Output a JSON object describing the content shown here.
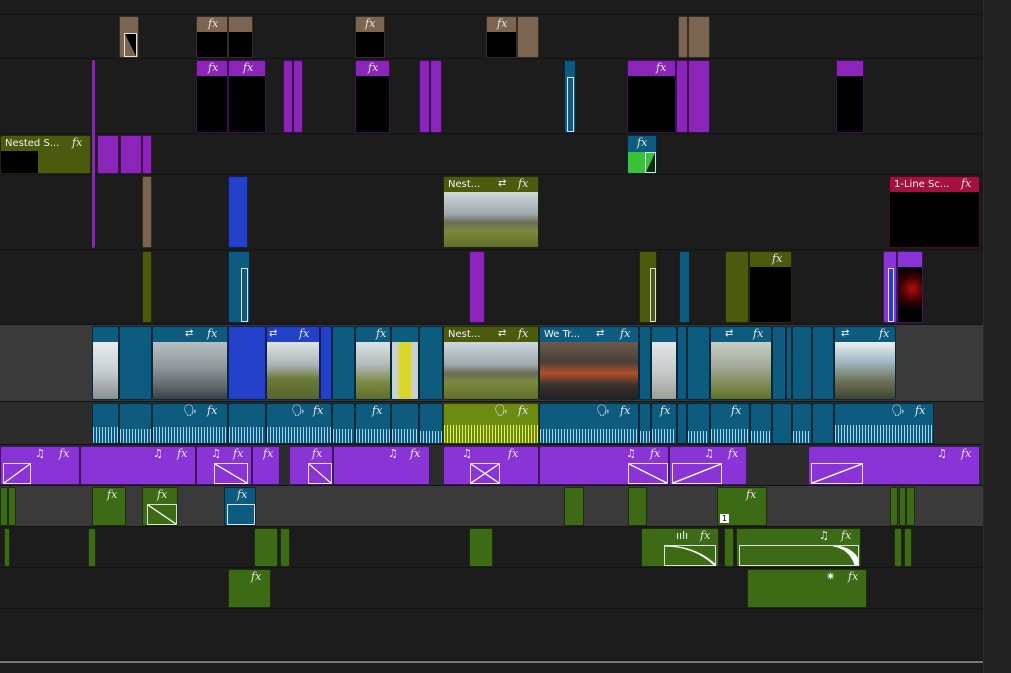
{
  "colors": {
    "brown": "#7b6550",
    "purple": "#8b24b8",
    "olive": "#4a5b0e",
    "teal": "#0d5c80",
    "blue": "#2340c8",
    "violet": "#8a34d8",
    "green": "#3d6a14",
    "crimson": "#a3123f",
    "lime": "#39c23a",
    "black": "#000000"
  },
  "labels": {
    "fx": "fx",
    "nested": "Nested S...",
    "nest": "Nest...",
    "line_scene": "1-Line Sc...",
    "we_tr": "We Tr...",
    "note": "♫",
    "voice": "🗣",
    "sync": "⇄",
    "star": "✷",
    "wave": "ıılı",
    "one": "1"
  },
  "tracks": [
    {
      "id": "v8",
      "kind": "dark"
    },
    {
      "id": "v7",
      "kind": "dark"
    },
    {
      "id": "v6",
      "kind": "dark"
    },
    {
      "id": "v5",
      "kind": "dark"
    },
    {
      "id": "v4",
      "kind": "dark"
    },
    {
      "id": "v3",
      "kind": "dark"
    },
    {
      "id": "v2",
      "kind": "light"
    },
    {
      "id": "a1",
      "kind": "mid"
    },
    {
      "id": "a2",
      "kind": "mid"
    },
    {
      "id": "a3",
      "kind": "light"
    },
    {
      "id": "a4",
      "kind": "dark"
    },
    {
      "id": "a5",
      "kind": "dark"
    },
    {
      "id": "a6",
      "kind": "dark"
    }
  ]
}
